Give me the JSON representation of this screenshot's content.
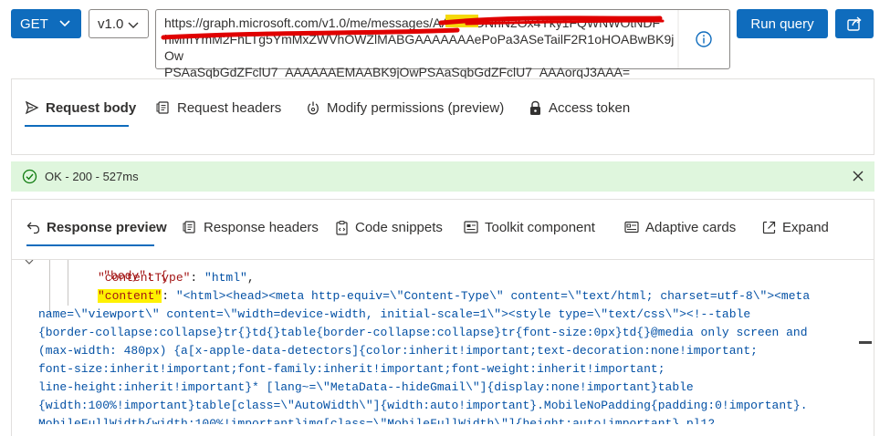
{
  "toolbar": {
    "method": "GET",
    "version": "v1.0",
    "url_line1": "https://graph.microsoft.com/v1.0/me/messages/AAMkADNhN2Ox4Yky1FQWNWOtNDF",
    "url_line2": "hMmYmM2FhLTg5YmMxZWVhOWZlMABGAAAAAAAePoPa3ASeTailF2R1oHOABwBK9jOw",
    "url_line3": "PSAaSqbGdZFclU7_AAAAAAEMAABK9jOwPSAaSqbGdZFclU7_AAAorqJ3AAA=",
    "run_label": "Run query",
    "icons": {
      "method_chevron": "chevron-down-icon",
      "info": "info-icon",
      "share": "share-icon"
    }
  },
  "request_tabs": [
    {
      "label": "Request body",
      "icon": "send-icon",
      "active": true
    },
    {
      "label": "Request headers",
      "icon": "headers-icon",
      "active": false
    },
    {
      "label": "Modify permissions (preview)",
      "icon": "permissions-icon",
      "active": false
    },
    {
      "label": "Access token",
      "icon": "lock-icon",
      "active": false
    }
  ],
  "status": {
    "text": "OK - 200 - 527ms",
    "color": "#dff6dd",
    "icon": "check-circle-icon",
    "close_icon": "close-icon"
  },
  "response_tabs": [
    {
      "label": "Response preview",
      "icon": "undo-arrow-icon",
      "active": true
    },
    {
      "label": "Response headers",
      "icon": "headers-icon",
      "active": false
    },
    {
      "label": "Code snippets",
      "icon": "clipboard-icon",
      "active": false
    },
    {
      "label": "Toolkit component",
      "icon": "toolkit-icon",
      "active": false
    },
    {
      "label": "Adaptive cards",
      "icon": "card-icon",
      "active": false
    },
    {
      "label": "Expand",
      "icon": "expand-icon",
      "active": false
    }
  ],
  "code": {
    "line0": "\"body\": {",
    "content_type_key": "\"contentType\"",
    "content_type_val": "\"html\"",
    "content_key": "\"content\"",
    "content_val": [
      "\"<html><head><meta http-equiv=\\\"Content-Type\\\" content=\\\"text/html; charset=utf-8\\\"><meta",
      "name=\\\"viewport\\\" content=\\\"width=device-width, initial-scale=1\\\"><style type=\\\"text/css\\\"><!--table",
      "{border-collapse:collapse}tr{}td{}table{border-collapse:collapse}tr{font-size:0px}td{}@media only screen and",
      "(max-width: 480px) {a[x-apple-data-detectors]{color:inherit!important;text-decoration:none!important;",
      "font-size:inherit!important;font-family:inherit!important;font-weight:inherit!important;",
      "line-height:inherit!important}* [lang~=\\\"MetaData--hideGmail\\\"]{display:none!important}table",
      "{width:100%!important}table[class=\\\"AutoWidth\\\"]{width:auto!important}.MobileNoPadding{padding:0!important}.",
      "MobileFullWidth{width:100%!important}img[class=\\\"MobileFullWidth\\\"]{height:auto!important}.pl12"
    ]
  }
}
